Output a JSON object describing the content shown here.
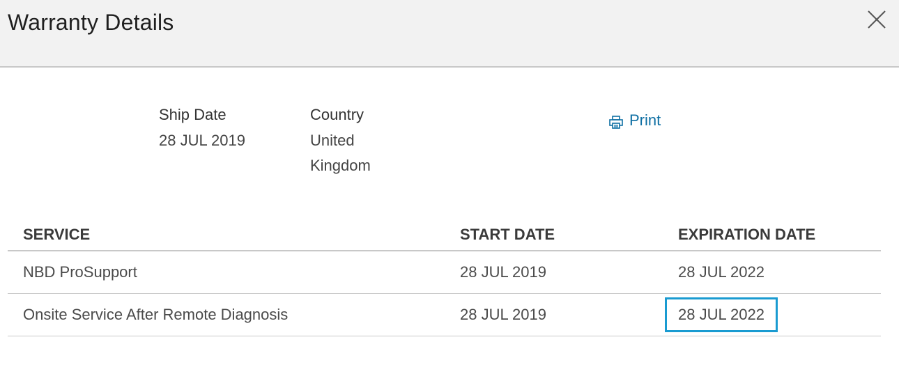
{
  "header": {
    "title": "Warranty Details",
    "close_icon": "close-icon"
  },
  "info": {
    "ship_date_label": "Ship Date",
    "ship_date_value": "28 JUL 2019",
    "country_label": "Country",
    "country_value_line1": "United",
    "country_value_line2": "Kingdom"
  },
  "print": {
    "icon": "printer-icon",
    "label": "Print",
    "color": "#0e6fa3"
  },
  "table": {
    "columns": [
      "SERVICE",
      "START DATE",
      "EXPIRATION DATE"
    ],
    "rows": [
      {
        "service": "NBD ProSupport",
        "start_date": "28 JUL 2019",
        "expiration_date": "28 JUL 2022"
      },
      {
        "service": "Onsite Service After Remote Diagnosis",
        "start_date": "28 JUL 2019",
        "expiration_date": "28 JUL 2022",
        "highlighted": true
      }
    ],
    "highlight_color": "#1a9bd1"
  }
}
